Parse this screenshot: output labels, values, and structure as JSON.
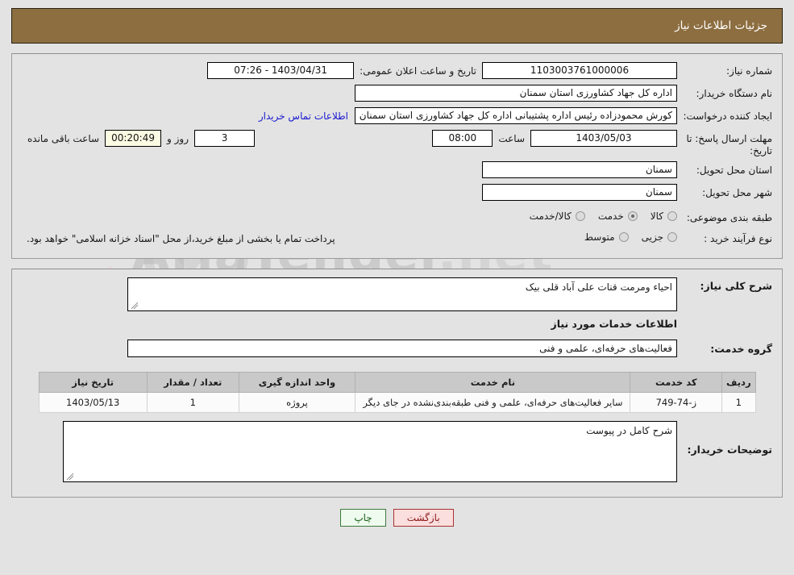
{
  "header": {
    "title": "جزئیات اطلاعات نیاز",
    "bar_color": "#8d6e40"
  },
  "info_panel": {
    "need_number_label": "شماره نیاز:",
    "need_number_value": "1103003761000006",
    "announce_label": "تاریخ و ساعت اعلان عمومی:",
    "announce_value": "1403/04/31 - 07:26",
    "buyer_org_label": "نام دستگاه خریدار:",
    "buyer_org_value": "اداره کل جهاد کشاورزی استان سمنان",
    "creator_label": "ایجاد کننده درخواست:",
    "creator_value": "کورش محمودزاده رئیس اداره پشتیبانی اداره کل جهاد کشاورزی استان سمنان",
    "contact_link": "اطلاعات تماس خریدار",
    "deadline_label": "مهلت ارسال پاسخ: تا تاریخ:",
    "deadline_value": "1403/05/03",
    "hour_label": "ساعت",
    "hour_value": "08:00",
    "days_value": "3",
    "days_and_label": "روز و",
    "countdown_value": "00:20:49",
    "remaining_label": "ساعت باقی مانده",
    "province_label": "استان محل تحویل:",
    "province_value": "سمنان",
    "city_label": "شهر محل تحویل:",
    "city_value": "سمنان",
    "category_label": "طبقه بندی موضوعی:",
    "category_options": [
      {
        "label": "کالا",
        "selected": false
      },
      {
        "label": "خدمت",
        "selected": true
      },
      {
        "label": "کالا/خدمت",
        "selected": false
      }
    ],
    "process_label": "نوع فرآیند خرید :",
    "process_options": [
      {
        "label": "جزیی",
        "selected": false
      },
      {
        "label": "متوسط",
        "selected": false
      }
    ],
    "payment_note": "پرداخت تمام یا بخشی از مبلغ خرید،از محل \"اسناد خزانه اسلامی\" خواهد بود."
  },
  "detail_panel": {
    "brief_label": "شرح کلی نیاز:",
    "brief_value": "احیاء ومرمت قنات علی آباد قلی بیک",
    "services_title": "اطلاعات خدمات مورد نیاز",
    "group_label": "گروه خدمت:",
    "group_value": "فعالیت‌های حرفه‌ای، علمی و فنی",
    "table": {
      "columns": [
        "ردیف",
        "کد خدمت",
        "نام خدمت",
        "واحد اندازه گیری",
        "تعداد / مقدار",
        "تاریخ نیاز"
      ],
      "rows": [
        {
          "row": "1",
          "code": "ز-74-749",
          "name": "سایر فعالیت‌های حرفه‌ای، علمی و فنی طبقه‌بندی‌نشده در جای دیگر",
          "unit": "پروژه",
          "qty": "1",
          "date": "1403/05/13"
        }
      ]
    },
    "remarks_label": "توضیحات خریدار:",
    "remarks_value": "شرح کامل در پیوست"
  },
  "buttons": {
    "print": "چاپ",
    "back": "بازگشت"
  },
  "watermark": {
    "brand": "AriaTender",
    "tld": ".net"
  }
}
